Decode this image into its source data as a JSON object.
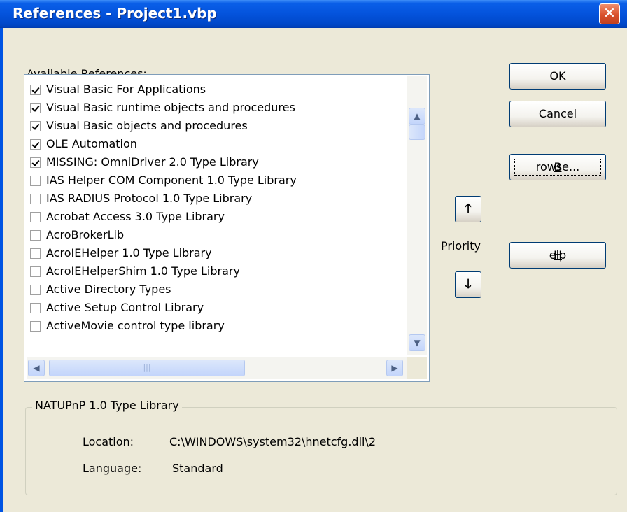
{
  "window": {
    "title": "References - Project1.vbp",
    "close_icon": "close-x"
  },
  "available_label": {
    "prefix": "A",
    "rest": "vailable References:"
  },
  "references": [
    {
      "label": "Visual Basic For Applications",
      "checked": true
    },
    {
      "label": "Visual Basic runtime objects and procedures",
      "checked": true
    },
    {
      "label": "Visual Basic objects and procedures",
      "checked": true
    },
    {
      "label": "OLE Automation",
      "checked": true
    },
    {
      "label": "MISSING: OmniDriver 2.0 Type Library",
      "checked": true
    },
    {
      "label": " IAS Helper COM Component 1.0 Type Library",
      "checked": false
    },
    {
      "label": " IAS RADIUS Protocol 1.0 Type Library",
      "checked": false
    },
    {
      "label": "Acrobat Access 3.0 Type Library",
      "checked": false
    },
    {
      "label": "AcroBrokerLib",
      "checked": false
    },
    {
      "label": "AcroIEHelper 1.0 Type Library",
      "checked": false
    },
    {
      "label": "AcroIEHelperShim 1.0 Type Library",
      "checked": false
    },
    {
      "label": "Active Directory Types",
      "checked": false
    },
    {
      "label": "Active Setup Control Library",
      "checked": false
    },
    {
      "label": "ActiveMovie control type library",
      "checked": false
    }
  ],
  "buttons": {
    "ok": "OK",
    "cancel": "Cancel",
    "browse_prefix": "B",
    "browse_rest": "rowse...",
    "help_prefix": "H",
    "help_rest": "elp"
  },
  "priority": {
    "label": "Priority",
    "up_icon": "arrow-up",
    "down_icon": "arrow-down"
  },
  "details": {
    "title": "NATUPnP 1.0 Type Library",
    "location_label": "Location:",
    "location_value": "C:\\WINDOWS\\system32\\hnetcfg.dll\\2",
    "language_label": "Language:",
    "language_value": "Standard"
  }
}
